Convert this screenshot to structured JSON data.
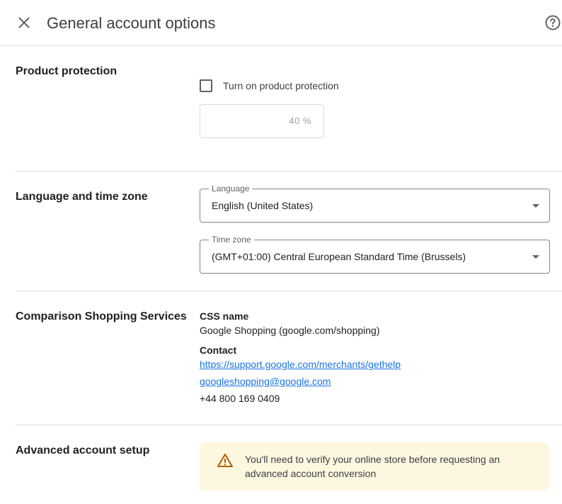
{
  "header": {
    "title": "General account options",
    "close_icon": "close-icon",
    "help_icon": "help-circle-icon"
  },
  "product_protection": {
    "title": "Product protection",
    "checkbox_label": "Turn on product protection",
    "checkbox_checked": false,
    "percent_value": "40 %"
  },
  "language_time": {
    "title": "Language and time zone",
    "language_label": "Language",
    "language_value": "English (United States)",
    "timezone_label": "Time zone",
    "timezone_value": "(GMT+01:00) Central European Standard Time (Brussels)"
  },
  "css": {
    "title": "Comparison Shopping Services",
    "name_label": "CSS name",
    "name_value": "Google Shopping (google.com/shopping)",
    "contact_label": "Contact",
    "contact_link": "https://support.google.com/merchants/gethelp",
    "contact_email": "googleshopping@google.com",
    "contact_phone": "+44 800 169 0409"
  },
  "advanced": {
    "title": "Advanced account setup",
    "warning_text": "You'll need to verify your online store before requesting an advanced account conversion",
    "warning_icon": "warning-triangle-icon"
  },
  "colors": {
    "link": "#1a73e8",
    "warning_bg": "#fef7e0",
    "warning_icon": "#b06000",
    "divider": "#dadce0"
  }
}
